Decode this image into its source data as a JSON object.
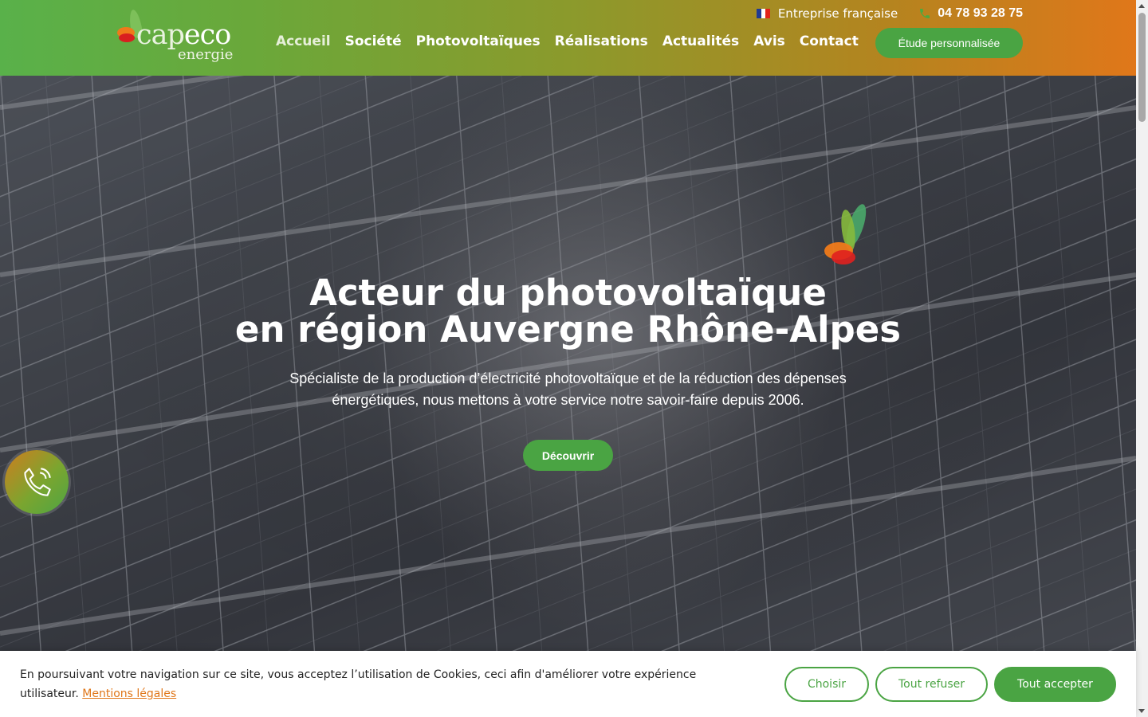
{
  "header": {
    "logo_text": "cap",
    "logo_text_eco": "eco",
    "logo_sub": "energie",
    "company_label": "Entreprise française",
    "phone": "04 78 93 28 75",
    "nav": [
      {
        "label": "Accueil"
      },
      {
        "label": "Société"
      },
      {
        "label": "Photovoltaïques"
      },
      {
        "label": "Réalisations"
      },
      {
        "label": "Actualités"
      },
      {
        "label": "Avis"
      },
      {
        "label": "Contact"
      }
    ],
    "cta_label": "Étude personnalisée",
    "flag_colors": [
      "#1f3a93",
      "#ffffff",
      "#e2231a"
    ]
  },
  "hero": {
    "title": "Acteur du photovoltaïque",
    "subtitle": "en région Auvergne Rhône-Alpes",
    "text": "Spécialiste de la production d’électricité photovoltaïque et de la réduction des dépenses énergétiques, nous mettons à votre service notre savoir-faire depuis 2006.",
    "button_label": "Découvrir"
  },
  "cookie": {
    "text": "En poursuivant votre navigation sur ce site, vous acceptez l’utilisation de Cookies, ceci afin d'améliorer votre expérience utilisateur.",
    "link_label": "Mentions légales",
    "choose_label": "Choisir",
    "refuse_label": "Tout refuser",
    "accept_label": "Tout accepter"
  },
  "colors": {
    "brand_green": "#4aa443",
    "brand_orange": "#e0771a"
  },
  "icons": {
    "phone": "phone-icon",
    "call_float": "phone-call-icon",
    "flag": "french-flag-icon",
    "butterfly": "butterfly-logo-icon"
  }
}
